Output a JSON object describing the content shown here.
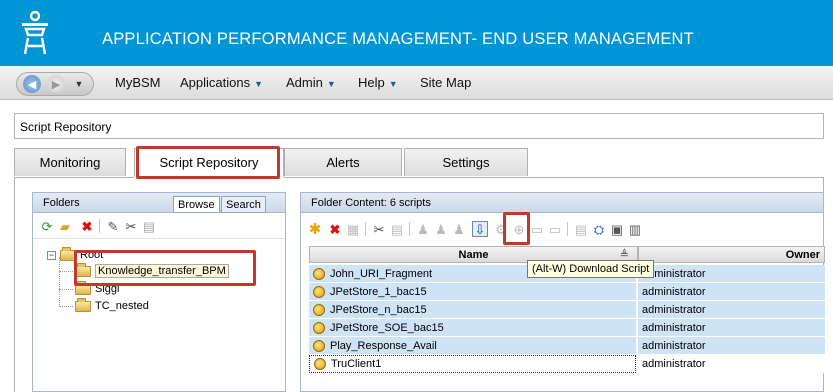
{
  "header": {
    "title": "APPLICATION PERFORMANCE MANAGEMENT- END USER MANAGEMENT",
    "logo": "hp-tower-logo"
  },
  "nav": {
    "back": "back-arrow-icon",
    "forward": "forward-arrow-icon",
    "items": [
      {
        "label": "MyBSM",
        "dropdown": false
      },
      {
        "label": "Applications",
        "dropdown": true
      },
      {
        "label": "Admin",
        "dropdown": true
      },
      {
        "label": "Help",
        "dropdown": true
      },
      {
        "label": "Site Map",
        "dropdown": false
      }
    ]
  },
  "breadcrumb": "Script Repository",
  "tabs": [
    {
      "label": "Monitoring",
      "active": false
    },
    {
      "label": "Script Repository",
      "active": true
    },
    {
      "label": "Alerts",
      "active": false
    },
    {
      "label": "Settings",
      "active": false
    }
  ],
  "folders_panel": {
    "title": "Folders",
    "subtabs": [
      "Browse",
      "Search"
    ],
    "active_subtab": "Browse",
    "toolbar_icons": [
      "refresh-icon",
      "new-folder-icon",
      "delete-icon",
      "edit-icon",
      "cut-icon",
      "paste-icon"
    ],
    "tree": {
      "root": "Root",
      "children": [
        {
          "label": "Knowledge_transfer_BPM",
          "selected": true
        },
        {
          "label": "Siggi",
          "selected": false
        },
        {
          "label": "TC_nested",
          "selected": false
        }
      ]
    }
  },
  "content_panel": {
    "title": "Folder Content: 6 scripts",
    "toolbar_icons": [
      "new-script-icon",
      "delete-icon",
      "upload-icon",
      "cut-icon",
      "paste-icon",
      "check-out-icon",
      "check-in-icon",
      "undo-check-out-icon",
      "download-icon",
      "compare-icon",
      "view-icon",
      "history-icon",
      "properties-icon",
      "find-icon",
      "export-icon",
      "clear-icon",
      "calculator-icon"
    ],
    "tooltip": "(Alt-W) Download Script",
    "columns": [
      "Name",
      "Owner"
    ],
    "sort_indicator": "≜",
    "rows": [
      {
        "name": "John_URI_Fragment",
        "owner": "administrator"
      },
      {
        "name": "JPetStore_1_bac15",
        "owner": "administrator"
      },
      {
        "name": "JPetStore_n_bac15",
        "owner": "administrator"
      },
      {
        "name": "JPetStore_SOE_bac15",
        "owner": "administrator"
      },
      {
        "name": "Play_Response_Avail",
        "owner": "administrator"
      },
      {
        "name": "TruClient1",
        "owner": "administrator"
      }
    ]
  },
  "accent": "#0096d6",
  "highlight_color": "#c0392b"
}
